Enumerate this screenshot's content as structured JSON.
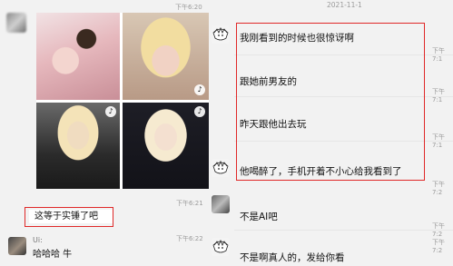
{
  "left_chat": {
    "time_top": "下午6:20",
    "time_mid": "下午6:21",
    "time_bottom": "下午6:22",
    "message_1": "这等于实锤了吧",
    "sender_2": "Ui:",
    "message_2": "哈哈哈 牛",
    "tiktok_icon": "♪"
  },
  "right_chat": {
    "date": "2021-11-1",
    "messages": [
      {
        "text": "我刚看到的时候也很惊讶啊",
        "time": "下午7:1"
      },
      {
        "text": "跟她前男友的",
        "time": "下午7:1"
      },
      {
        "text": "昨天跟他出去玩",
        "time": "下午7:1"
      },
      {
        "text": "他喝醉了，手机开着不小心给我看到了",
        "time": "下午7:2"
      },
      {
        "text": "不是AI吧",
        "time": "下午7:2"
      },
      {
        "text": "不是啊真人的，发给你看",
        "time": "下午7:2"
      }
    ]
  },
  "colors": {
    "highlight": "#e02828",
    "background": "#f2f2f2"
  }
}
